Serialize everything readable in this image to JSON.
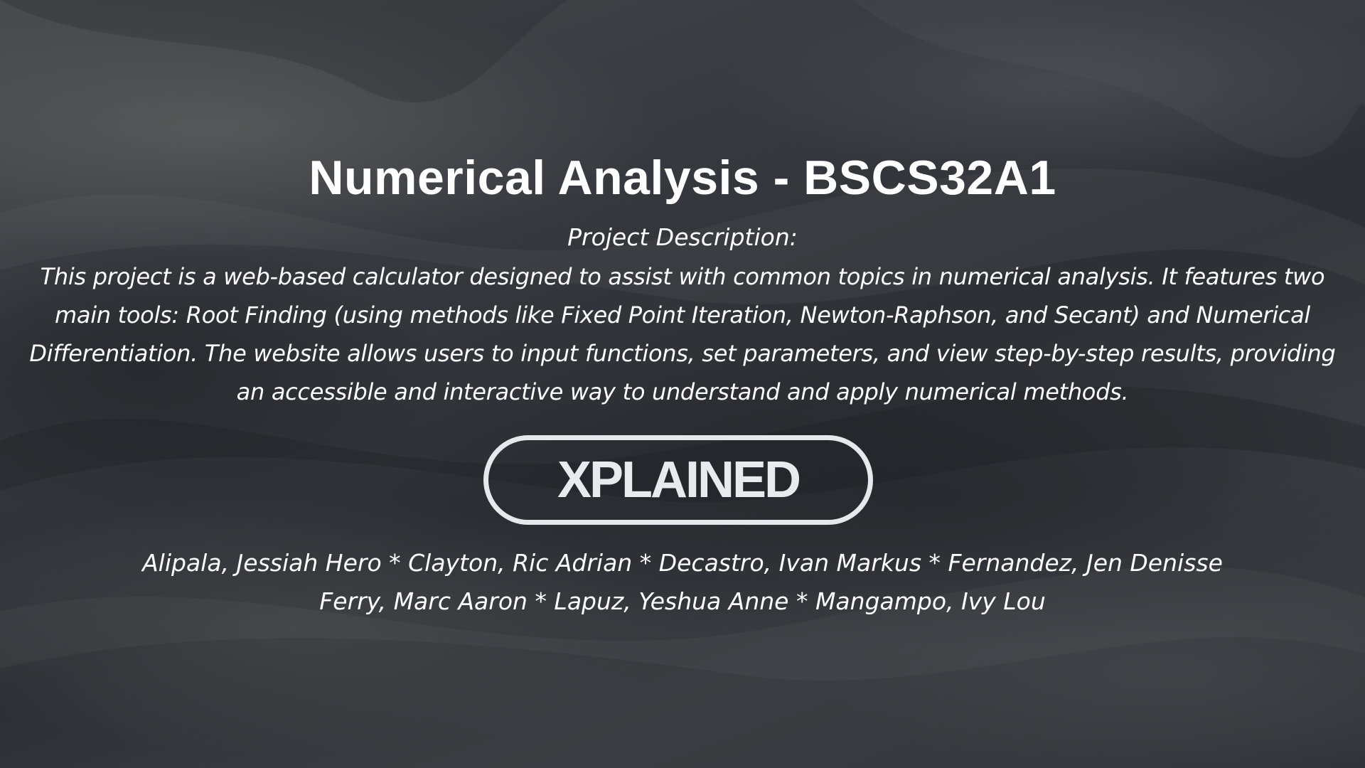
{
  "slide": {
    "title": "Numerical Analysis - BSCS32A1",
    "description_heading": "Project Description:",
    "description_body": "This project is a web-based calculator designed to assist with common topics in numerical analysis. It features two main tools: Root Finding (using methods like Fixed Point Iteration, Newton-Raphson, and Secant) and Numerical Differentiation. The website allows users to input functions, set parameters, and view step-by-step results, providing an accessible and interactive way to understand and apply numerical methods.",
    "logo_text": "XPLAINED",
    "authors_line_1": "Alipala, Jessiah Hero * Clayton, Ric Adrian * Decastro, Ivan Markus * Fernandez, Jen Denisse",
    "authors_line_2": "Ferry, Marc Aaron * Lapuz, Yeshua Anne * Mangampo, Ivy Lou"
  },
  "colors": {
    "text": "#ffffff",
    "logo": "#e8eaee",
    "background": "#3a3d42"
  }
}
